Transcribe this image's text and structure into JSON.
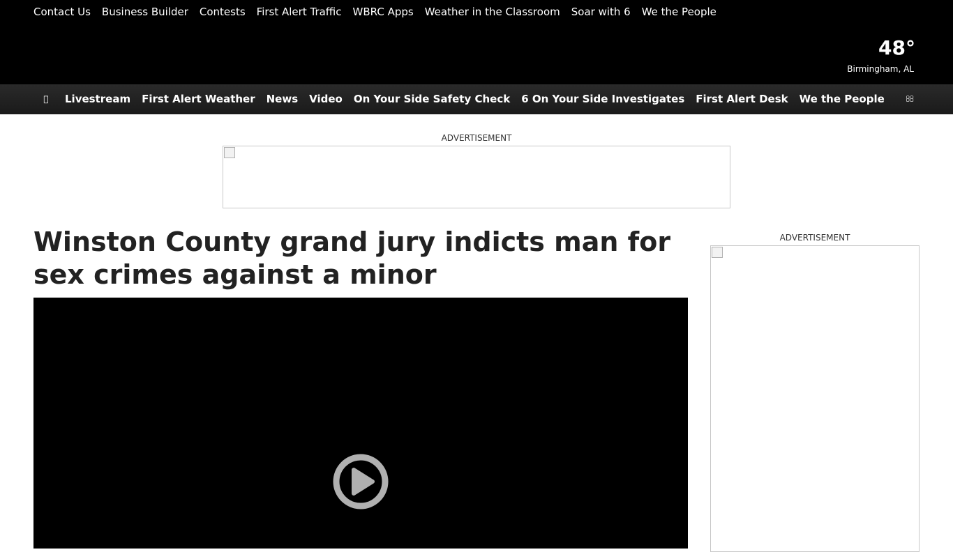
{
  "utility_nav": [
    {
      "label": "Contact Us"
    },
    {
      "label": "Business Builder"
    },
    {
      "label": "Contests"
    },
    {
      "label": "First Alert Traffic"
    },
    {
      "label": "WBRC Apps"
    },
    {
      "label": "Weather in the Classroom"
    },
    {
      "label": "Soar with 6"
    },
    {
      "label": "We the People"
    }
  ],
  "weather": {
    "temperature": "48°",
    "location": "Birmingham, AL"
  },
  "main_nav": {
    "menu_icon": "menu-icon",
    "search_icon": "search-icon",
    "links": [
      {
        "label": "Livestream"
      },
      {
        "label": "First Alert Weather"
      },
      {
        "label": "News"
      },
      {
        "label": "Video"
      },
      {
        "label": "On Your Side Safety Check"
      },
      {
        "label": "6 On Your Side Investigates"
      },
      {
        "label": "First Alert Desk"
      },
      {
        "label": "We the People"
      }
    ]
  },
  "ads": {
    "top_label": "ADVERTISEMENT",
    "side_label": "ADVERTISEMENT"
  },
  "article": {
    "headline": "Winston County grand jury indicts man for sex crimes against a minor"
  },
  "video": {
    "play_icon": "play-icon"
  },
  "colors": {
    "header_bg": "#000000",
    "nav_bg": "#222222",
    "headline_text": "#222222",
    "play_button": "#b0b0b0"
  }
}
